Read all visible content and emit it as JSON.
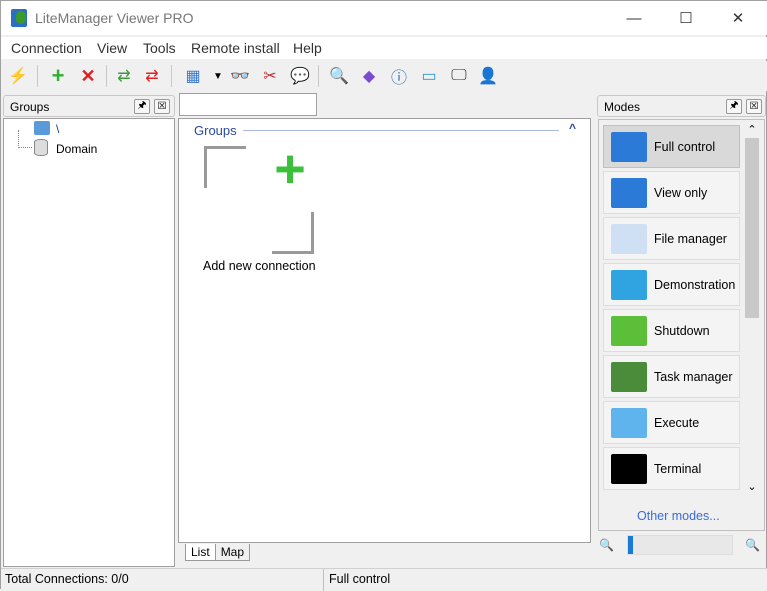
{
  "window": {
    "title": "LiteManager Viewer PRO",
    "minimize": "—",
    "maximize": "☐",
    "close": "✕"
  },
  "menu": [
    "Connection",
    "View",
    "Tools",
    "Remote install",
    "Help"
  ],
  "toolbar": [
    "connect-icon",
    "add-icon",
    "delete-icon",
    "refresh-icon",
    "refresh-red-icon",
    "view-mode-icon",
    "dropdown-icon",
    "binoculars-icon",
    "tools-icon",
    "chat-icon",
    "search-icon",
    "network-icon",
    "info-icon",
    "computer-network-icon",
    "monitor-icon",
    "user-icon"
  ],
  "groups_panel": {
    "title": "Groups",
    "pin": "🖈",
    "close": "☒",
    "tree": [
      "\\",
      "Domain"
    ]
  },
  "center": {
    "search_value": "",
    "section_title": "Groups",
    "add_label": "Add new connection",
    "tabs": [
      "List",
      "Map"
    ],
    "collapse": "^"
  },
  "modes_panel": {
    "title": "Modes",
    "pin": "🖈",
    "close": "☒",
    "items": [
      {
        "label": "Full control",
        "selected": true,
        "color": "#2b7ad8"
      },
      {
        "label": "View only",
        "color": "#2b7ad8"
      },
      {
        "label": "File manager",
        "color": "#cfe0f5"
      },
      {
        "label": "Demonstration",
        "color": "#2fa4e0"
      },
      {
        "label": "Shutdown",
        "color": "#5cbf3a"
      },
      {
        "label": "Task manager",
        "color": "#4a8c3a"
      },
      {
        "label": "Execute",
        "color": "#5fb4ee"
      },
      {
        "label": "Terminal",
        "color": "#000000"
      }
    ],
    "other_modes": "Other modes...",
    "zoom_level": 0.05
  },
  "status": {
    "connections": "Total Connections:  0/0",
    "mode": "Full control"
  }
}
